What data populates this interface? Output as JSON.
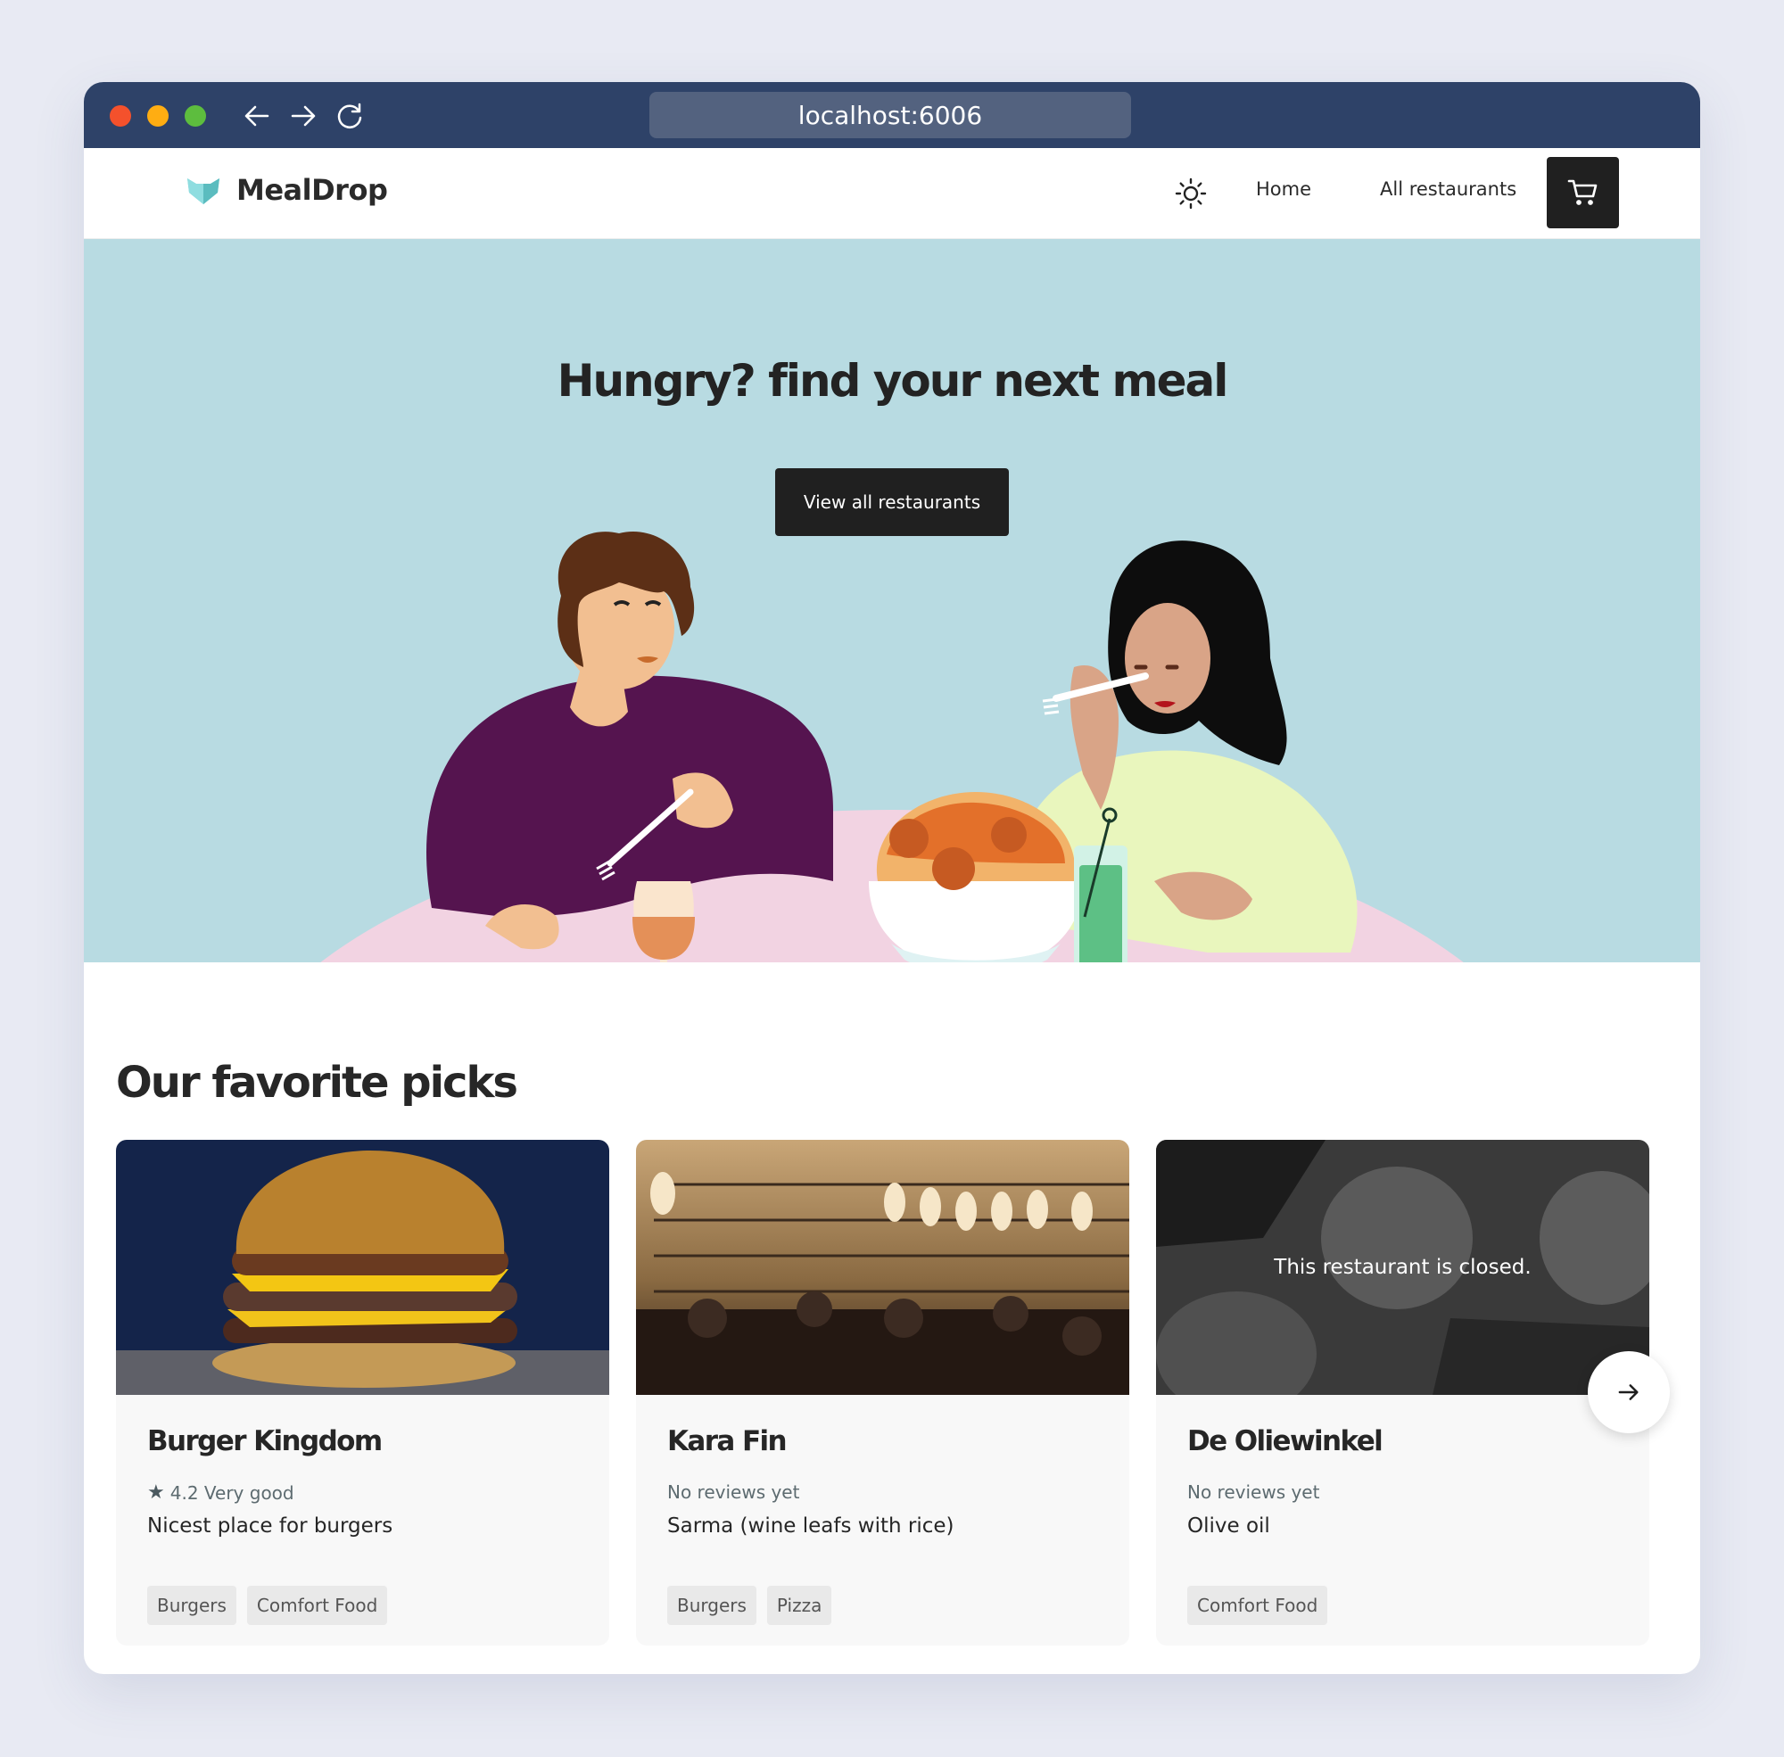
{
  "browser": {
    "url": "localhost:6006",
    "icons": {
      "back": "arrow-left-icon",
      "forward": "arrow-right-icon",
      "reload": "reload-icon"
    }
  },
  "header": {
    "brand": "MealDrop",
    "logo_icon": "fox-head-logo",
    "logo_color": "#6fcfcf",
    "theme_toggle_icon": "sun-icon",
    "nav": [
      {
        "label": "Home"
      },
      {
        "label": "All restaurants"
      }
    ],
    "cart_icon": "shopping-cart-icon"
  },
  "hero": {
    "title": "Hungry? find your next meal",
    "cta_label": "View all restaurants",
    "background": "#b8dbe2",
    "illustration": "two-people-eating-spaghetti-illustration"
  },
  "picks": {
    "title": "Our favorite picks",
    "next_icon": "arrow-right-icon",
    "restaurants": [
      {
        "name": "Burger Kingdom",
        "rating_icon": "star-icon",
        "rating": "4.2 Very good",
        "description": "Nicest place for burgers",
        "tags": [
          "Burgers",
          "Comfort Food"
        ],
        "image": "burger-photo",
        "closed": false
      },
      {
        "name": "Kara Fin",
        "rating": "No reviews yet",
        "description": "Sarma (wine leafs with rice)",
        "tags": [
          "Burgers",
          "Pizza"
        ],
        "image": "restaurant-bar-interior-photo",
        "closed": false
      },
      {
        "name": "De Oliewinkel",
        "rating": "No reviews yet",
        "description": "Olive oil",
        "tags": [
          "Comfort Food"
        ],
        "image": "burgers-and-fries-photo",
        "closed": true,
        "closed_message": "This restaurant is closed."
      }
    ]
  }
}
